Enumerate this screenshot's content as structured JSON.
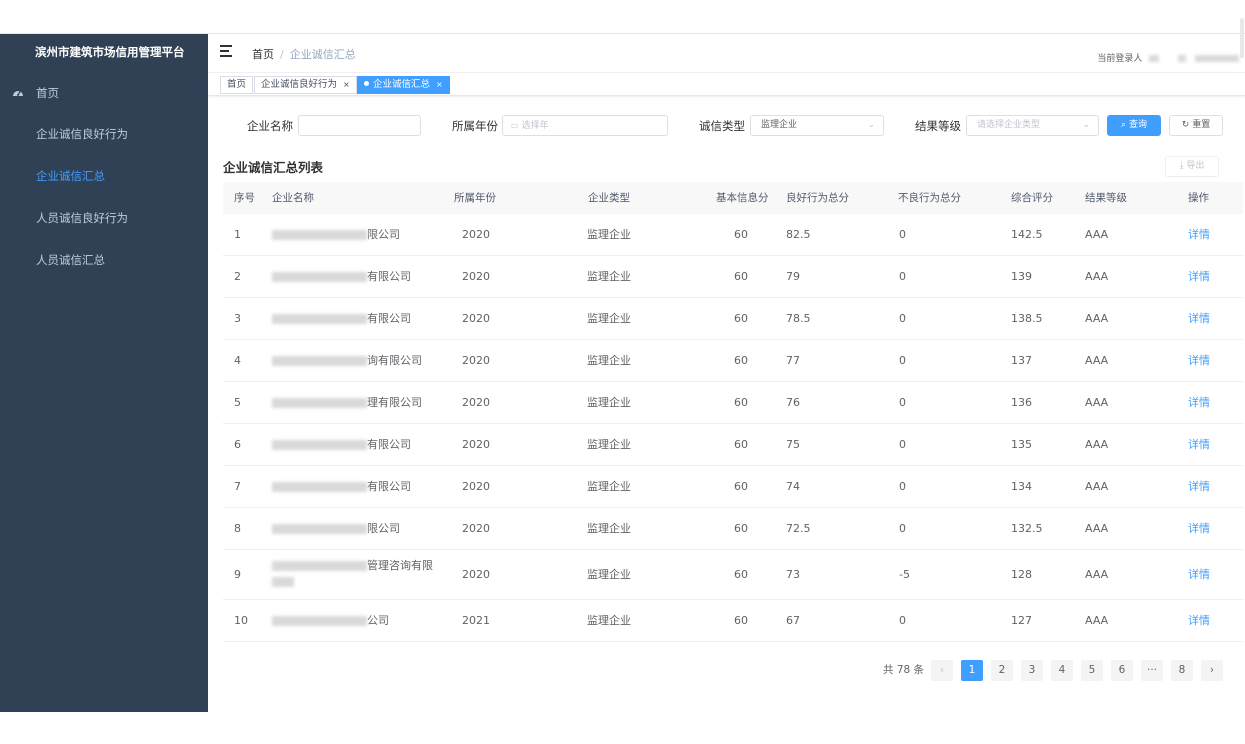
{
  "sidebar": {
    "title": "滨州市建筑市场信用管理平台",
    "items": [
      {
        "label": "首页",
        "icon": "dashboard-icon"
      },
      {
        "label": "企业诚信良好行为"
      },
      {
        "label": "企业诚信汇总",
        "active": true
      },
      {
        "label": "人员诚信良好行为"
      },
      {
        "label": "人员诚信汇总"
      }
    ]
  },
  "navbar": {
    "breadcrumb_home": "首页",
    "breadcrumb_sep": "/",
    "breadcrumb_current": "企业诚信汇总",
    "user_label": "当前登录人"
  },
  "tags": [
    {
      "label": "首页"
    },
    {
      "label": "企业诚信良好行为",
      "close": "×"
    },
    {
      "label": "企业诚信汇总",
      "close": "×",
      "active": true
    }
  ],
  "filters": {
    "company_label": "企业名称",
    "company_value": "",
    "year_label": "所属年份",
    "year_placeholder": "选择年",
    "type_label": "诚信类型",
    "type_value": "监理企业",
    "grade_label": "结果等级",
    "grade_placeholder": "请选择企业类型",
    "search_button": "查询",
    "reset_button": "重置",
    "export_button": "导出"
  },
  "list_title": "企业诚信汇总列表",
  "table": {
    "headers": [
      "序号",
      "企业名称",
      "所属年份",
      "企业类型",
      "基本信息分",
      "良好行为总分",
      "不良行为总分",
      "综合评分",
      "结果等级",
      "操作"
    ],
    "rows": [
      {
        "no": "1",
        "name_suffix": "限公司",
        "year": "2020",
        "type": "监理企业",
        "basic": "60",
        "good": "82.5",
        "bad": "0",
        "total": "142.5",
        "grade": "AAA",
        "action": "详情"
      },
      {
        "no": "2",
        "name_suffix": "有限公司",
        "year": "2020",
        "type": "监理企业",
        "basic": "60",
        "good": "79",
        "bad": "0",
        "total": "139",
        "grade": "AAA",
        "action": "详情"
      },
      {
        "no": "3",
        "name_suffix": "有限公司",
        "year": "2020",
        "type": "监理企业",
        "basic": "60",
        "good": "78.5",
        "bad": "0",
        "total": "138.5",
        "grade": "AAA",
        "action": "详情"
      },
      {
        "no": "4",
        "name_suffix": "询有限公司",
        "year": "2020",
        "type": "监理企业",
        "basic": "60",
        "good": "77",
        "bad": "0",
        "total": "137",
        "grade": "AAA",
        "action": "详情"
      },
      {
        "no": "5",
        "name_suffix": "理有限公司",
        "year": "2020",
        "type": "监理企业",
        "basic": "60",
        "good": "76",
        "bad": "0",
        "total": "136",
        "grade": "AAA",
        "action": "详情"
      },
      {
        "no": "6",
        "name_suffix": "有限公司",
        "year": "2020",
        "type": "监理企业",
        "basic": "60",
        "good": "75",
        "bad": "0",
        "total": "135",
        "grade": "AAA",
        "action": "详情"
      },
      {
        "no": "7",
        "name_suffix": "有限公司",
        "year": "2020",
        "type": "监理企业",
        "basic": "60",
        "good": "74",
        "bad": "0",
        "total": "134",
        "grade": "AAA",
        "action": "详情"
      },
      {
        "no": "8",
        "name_suffix": "限公司",
        "year": "2020",
        "type": "监理企业",
        "basic": "60",
        "good": "72.5",
        "bad": "0",
        "total": "132.5",
        "grade": "AAA",
        "action": "详情"
      },
      {
        "no": "9",
        "name_suffix": "管理咨询有限",
        "year": "2020",
        "type": "监理企业",
        "basic": "60",
        "good": "73",
        "bad": "-5",
        "total": "128",
        "grade": "AAA",
        "action": "详情"
      },
      {
        "no": "10",
        "name_suffix": "公司",
        "year": "2021",
        "type": "监理企业",
        "basic": "60",
        "good": "67",
        "bad": "0",
        "total": "127",
        "grade": "AAA",
        "action": "详情"
      }
    ]
  },
  "pagination": {
    "total": "共 78 条",
    "pages": [
      "1",
      "2",
      "3",
      "4",
      "5",
      "6",
      "···",
      "8"
    ],
    "current": "1",
    "prev": "‹",
    "next": "›"
  }
}
